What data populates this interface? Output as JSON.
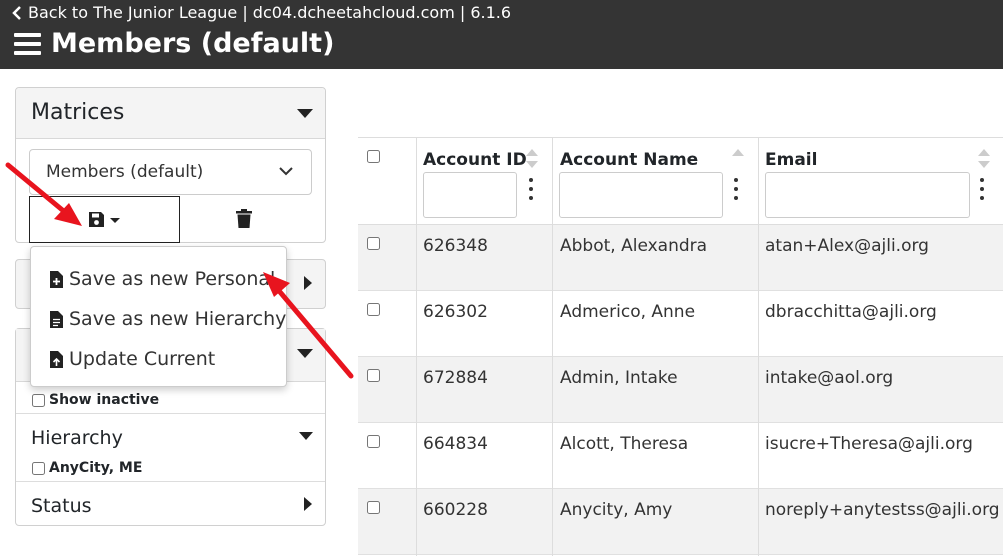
{
  "header": {
    "back_text": "Back to The Junior League | dc04.dcheetahcloud.com | 6.1.6",
    "title": "Members (default)"
  },
  "sidebar": {
    "matrices_title": "Matrices",
    "matrix_select_value": "Members (default)",
    "show_inactive_label": "Show inactive",
    "hierarchy_label": "Hierarchy",
    "hierarchy_option": "AnyCity, ME",
    "status_label": "Status"
  },
  "save_menu": {
    "items": [
      "Save as new Personal",
      "Save as new Hierarchy",
      "Update Current"
    ]
  },
  "table": {
    "headers": [
      "Account ID",
      "Account Name",
      "Email"
    ],
    "rows": [
      {
        "id": "626348",
        "name": "Abbot, Alexandra",
        "email": "atan+Alex@ajli.org"
      },
      {
        "id": "626302",
        "name": "Admerico, Anne",
        "email": "dbracchitta@ajli.org"
      },
      {
        "id": "672884",
        "name": "Admin, Intake",
        "email": "intake@aol.org"
      },
      {
        "id": "664834",
        "name": "Alcott, Theresa",
        "email": "isucre+Theresa@ajli.org"
      },
      {
        "id": "660228",
        "name": "Anycity, Amy",
        "email": "noreply+anytestss@ajli.org"
      }
    ]
  },
  "colors": {
    "header_bg": "#343434",
    "arrow": "#e8141e",
    "row_alt": "#f2f2f2"
  }
}
